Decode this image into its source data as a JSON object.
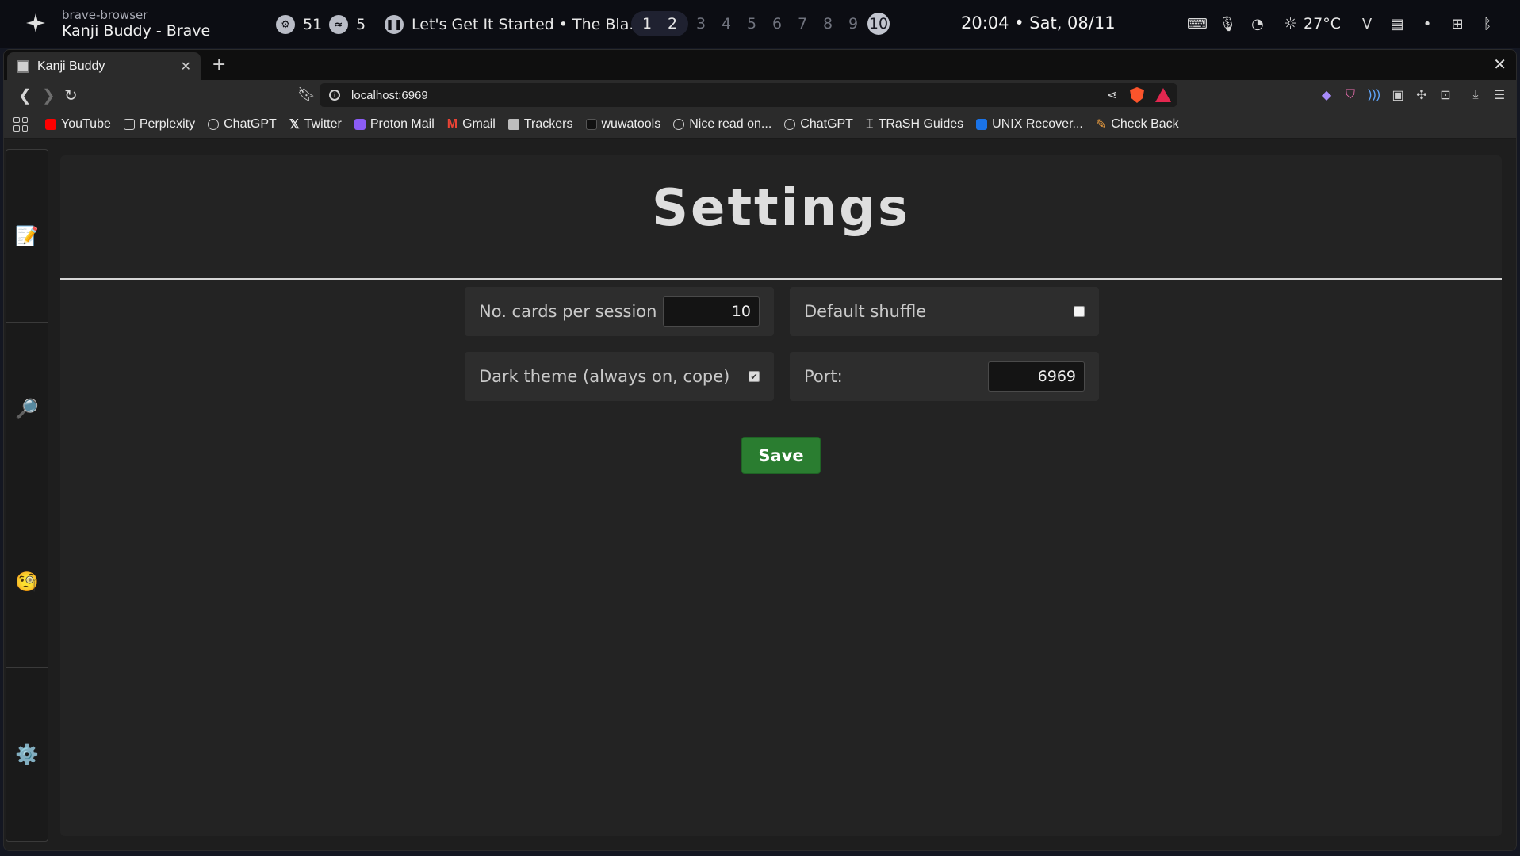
{
  "system_bar": {
    "app_name": "brave-browser",
    "window_title": "Kanji Buddy - Brave",
    "status_items": [
      {
        "icon": "cpu-icon",
        "value": "51"
      },
      {
        "icon": "temperature-icon",
        "value": "5"
      }
    ],
    "media_title": "Let's Get It Started • The Bla...",
    "workspaces": [
      "1",
      "2",
      "3",
      "4",
      "5",
      "6",
      "7",
      "8",
      "9",
      "10"
    ],
    "workspace_occupied": [
      "1",
      "2"
    ],
    "workspace_active": "10",
    "clock": "20:04 • Sat, 08/11",
    "weather": "27°C"
  },
  "browser": {
    "tab_title": "Kanji Buddy",
    "url": "localhost:6969",
    "bookmarks": [
      {
        "label": "YouTube",
        "color": "#ff0000"
      },
      {
        "label": "Perplexity",
        "color": "#20b8cd"
      },
      {
        "label": "ChatGPT",
        "color": "#cfcfcf"
      },
      {
        "label": "Twitter",
        "color": "#ffffff"
      },
      {
        "label": "Proton Mail",
        "color": "#8b5cf6"
      },
      {
        "label": "Gmail",
        "color": "#ea4335"
      },
      {
        "label": "Trackers",
        "color": "#cfcfcf"
      },
      {
        "label": "wuwatools",
        "color": "#444444"
      },
      {
        "label": "Nice read on...",
        "color": "#cfcfcf"
      },
      {
        "label": "ChatGPT",
        "color": "#cfcfcf"
      },
      {
        "label": "TRaSH Guides",
        "color": "#cfcfcf"
      },
      {
        "label": "UNIX Recover...",
        "color": "#1a73e8"
      },
      {
        "label": "Check Back",
        "color": "#f0a040"
      }
    ]
  },
  "sidebar": {
    "items": [
      {
        "name": "sidebar-item-notes",
        "icon": "📝"
      },
      {
        "name": "sidebar-item-search",
        "icon": "🔎"
      },
      {
        "name": "sidebar-item-quiz",
        "icon": "🧐"
      },
      {
        "name": "sidebar-item-settings",
        "icon": "⚙️"
      }
    ]
  },
  "settings": {
    "title": "Settings",
    "cards_label": "No. cards per session",
    "cards_value": "10",
    "shuffle_label": "Default shuffle",
    "shuffle_checked": false,
    "dark_label": "Dark theme (always on, cope)",
    "dark_checked": true,
    "port_label": "Port:",
    "port_value": "6969",
    "save_label": "Save"
  },
  "colors": {
    "save_button": "#2a7d30",
    "panel": "#232323"
  }
}
